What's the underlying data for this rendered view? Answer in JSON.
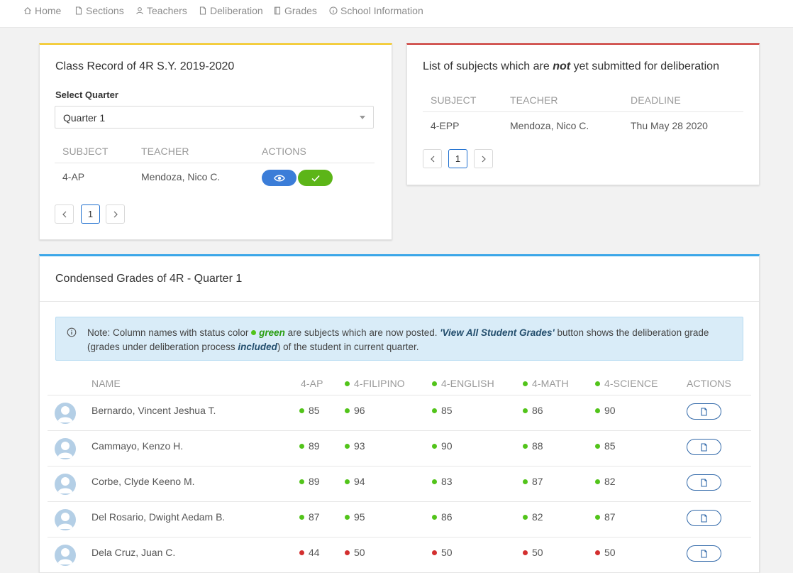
{
  "nav": [
    {
      "label": "Home",
      "icon": "home-icon"
    },
    {
      "label": "Sections",
      "icon": "file-icon"
    },
    {
      "label": "Teachers",
      "icon": "user-icon"
    },
    {
      "label": "Deliberation",
      "icon": "file-icon"
    },
    {
      "label": "Grades",
      "icon": "book-icon"
    },
    {
      "label": "School Information",
      "icon": "info-icon"
    }
  ],
  "class_record": {
    "title": "Class Record of 4R S.Y. 2019-2020",
    "select_label": "Select Quarter",
    "select_value": "Quarter 1",
    "headers": [
      "SUBJECT",
      "TEACHER",
      "ACTIONS"
    ],
    "rows": [
      {
        "subject": "4-AP",
        "teacher": "Mendoza, Nico C."
      }
    ],
    "page": "1",
    "accent": "#f2c312"
  },
  "not_submitted": {
    "title_pre": "List of subjects which are ",
    "title_em": "not",
    "title_post": " yet submitted for deliberation",
    "headers": [
      "SUBJECT",
      "TEACHER",
      "DEADLINE"
    ],
    "rows": [
      {
        "subject": "4-EPP",
        "teacher": "Mendoza, Nico C.",
        "deadline": "Thu May 28 2020"
      }
    ],
    "page": "1",
    "accent": "#c9302c"
  },
  "condensed": {
    "title": "Condensed Grades of 4R - Quarter 1",
    "accent": "#3aa6e8",
    "note": {
      "t1": "Note: Column names with status color ",
      "green": "green",
      "t2": " are subjects which are now posted. ",
      "button_name": "'View All Student Grades'",
      "t3": " button shows the deliberation grade (grades under deliberation process ",
      "included": "included",
      "t4": ") of the student in current quarter."
    },
    "headers": {
      "name": "NAME",
      "subjects": [
        {
          "label": "4-AP",
          "posted": false
        },
        {
          "label": "4-FILIPINO",
          "posted": true
        },
        {
          "label": "4-ENGLISH",
          "posted": true
        },
        {
          "label": "4-MATH",
          "posted": true
        },
        {
          "label": "4-SCIENCE",
          "posted": true
        }
      ],
      "actions": "ACTIONS"
    },
    "students": [
      {
        "name": "Bernardo, Vincent Jeshua T.",
        "grades": [
          {
            "v": "85",
            "s": "pass"
          },
          {
            "v": "96",
            "s": "pass"
          },
          {
            "v": "85",
            "s": "pass"
          },
          {
            "v": "86",
            "s": "pass"
          },
          {
            "v": "90",
            "s": "pass"
          }
        ]
      },
      {
        "name": "Cammayo, Kenzo H.",
        "grades": [
          {
            "v": "89",
            "s": "pass"
          },
          {
            "v": "93",
            "s": "pass"
          },
          {
            "v": "90",
            "s": "pass"
          },
          {
            "v": "88",
            "s": "pass"
          },
          {
            "v": "85",
            "s": "pass"
          }
        ]
      },
      {
        "name": "Corbe, Clyde Keeno M.",
        "grades": [
          {
            "v": "89",
            "s": "pass"
          },
          {
            "v": "94",
            "s": "pass"
          },
          {
            "v": "83",
            "s": "pass"
          },
          {
            "v": "87",
            "s": "pass"
          },
          {
            "v": "82",
            "s": "pass"
          }
        ]
      },
      {
        "name": "Del Rosario, Dwight Aedam B.",
        "grades": [
          {
            "v": "87",
            "s": "pass"
          },
          {
            "v": "95",
            "s": "pass"
          },
          {
            "v": "86",
            "s": "pass"
          },
          {
            "v": "82",
            "s": "pass"
          },
          {
            "v": "87",
            "s": "pass"
          }
        ]
      },
      {
        "name": "Dela Cruz, Juan C.",
        "grades": [
          {
            "v": "44",
            "s": "fail"
          },
          {
            "v": "50",
            "s": "fail"
          },
          {
            "v": "50",
            "s": "fail"
          },
          {
            "v": "50",
            "s": "fail"
          },
          {
            "v": "50",
            "s": "fail"
          }
        ]
      }
    ]
  },
  "colors": {
    "pass": "#52c41a",
    "fail": "#d32f2f",
    "primary": "#2f67a8",
    "view_button": "#3b7dd8",
    "approve_button": "#5cb518"
  }
}
